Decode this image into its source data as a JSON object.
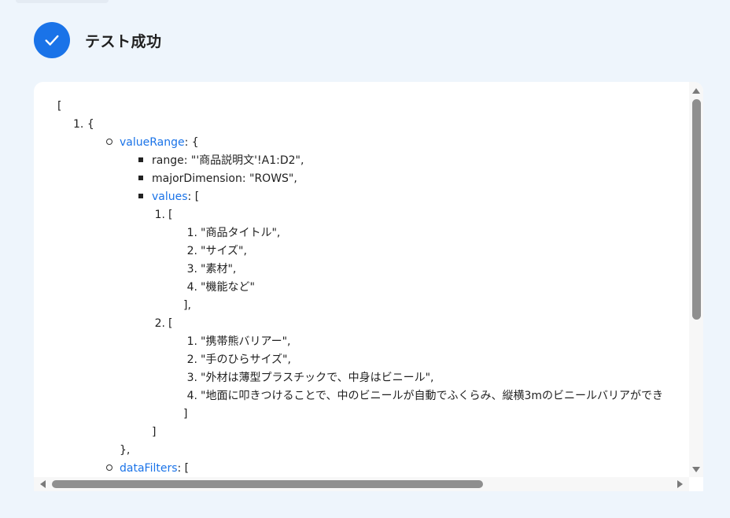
{
  "header": {
    "title": "テスト成功",
    "accent_color": "#1a73e8",
    "icon": "check-icon"
  },
  "result": {
    "open_bracket": "[",
    "item1_marker": "1.",
    "item1_open": "{",
    "valueRange_key": "valueRange",
    "valueRange_open": ": {",
    "range_line": "range: \"'商品説明文'!A1:D2\",",
    "majorDimension_line": "majorDimension: \"ROWS\",",
    "values_key": "values",
    "values_open": ": [",
    "row1_marker": "1.",
    "row1_open": "[",
    "row1_cells": [
      "\"商品タイトル\",",
      "\"サイズ\",",
      "\"素材\",",
      "\"機能など\""
    ],
    "row1_close": "],",
    "row2_marker": "2.",
    "row2_open": "[",
    "row2_cells": [
      "\"携帯熊バリアー\",",
      "\"手のひらサイズ\",",
      "\"外材は薄型プラスチックで、中身はビニール\",",
      "\"地面に叩きつけることで、中のビニールが自動でふくらみ、縦横3mのビニールバリアができ"
    ],
    "row2_close": "]",
    "values_close": "]",
    "valueRange_close": "},",
    "dataFilters_key": "dataFilters",
    "dataFilters_open": ": ["
  }
}
